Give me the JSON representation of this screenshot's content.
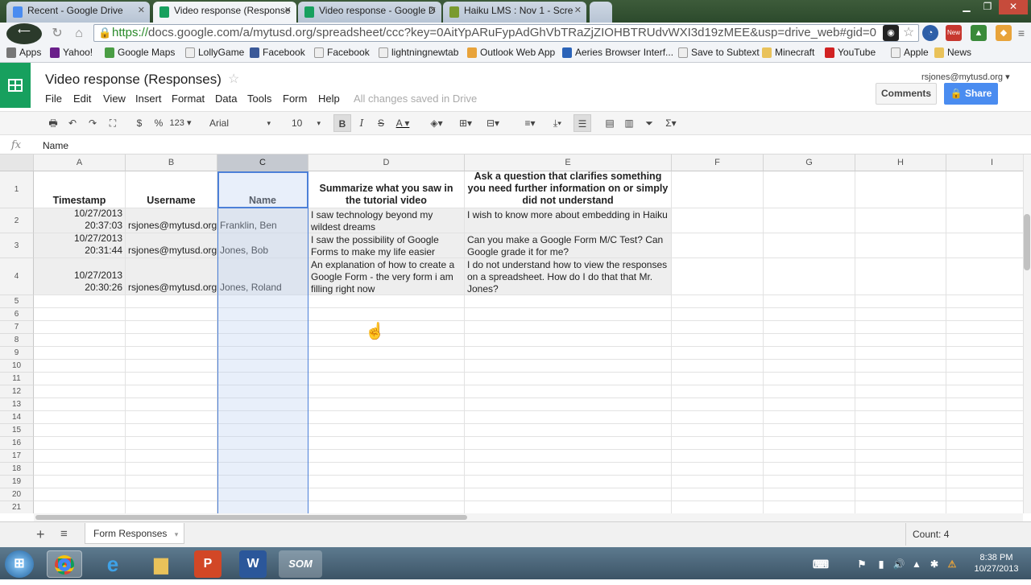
{
  "browser": {
    "tabs": [
      {
        "title": "Recent - Google Drive",
        "color": "#4a8cf0"
      },
      {
        "title": "Video response (Response",
        "color": "#17a05e",
        "active": true
      },
      {
        "title": "Video response - Google D",
        "color": "#17a05e"
      },
      {
        "title": "Haiku LMS : Nov 1 - Scre",
        "color": "#7a9a2e"
      }
    ],
    "url_scheme": "https://",
    "url_rest": "docs.google.com/a/mytusd.org/spreadsheet/ccc?key=0AitYpARuFypAdGhVbTRaZjZIOHBTRUdvWXI3d19zMEE&usp=drive_web#gid=0",
    "bookmarks": [
      {
        "label": "Apps",
        "icon": "apps-icon",
        "color": "#777"
      },
      {
        "label": "Yahoo!",
        "icon": "yahoo-icon",
        "color": "#6a1f8a"
      },
      {
        "label": "Google Maps",
        "icon": "maps-icon",
        "color": "#4a9d44"
      },
      {
        "label": "LollyGame",
        "icon": "page-icon",
        "color": "#eee"
      },
      {
        "label": "Facebook",
        "icon": "facebook-icon",
        "color": "#3b5998"
      },
      {
        "label": "Facebook",
        "icon": "page-icon",
        "color": "#eee"
      },
      {
        "label": "lightningnewtab",
        "icon": "page-icon",
        "color": "#eee"
      },
      {
        "label": "Outlook Web App",
        "icon": "outlook-icon",
        "color": "#e8a33a"
      },
      {
        "label": "Aeries Browser Interf...",
        "icon": "aeries-icon",
        "color": "#2b63b8"
      },
      {
        "label": "Save to Subtext",
        "icon": "page-icon",
        "color": "#eee"
      },
      {
        "label": "Minecraft",
        "icon": "folder-icon",
        "color": "#e9c25a"
      },
      {
        "label": "YouTube",
        "icon": "youtube-icon",
        "color": "#d12222"
      },
      {
        "label": "Apple",
        "icon": "page-icon",
        "color": "#eee"
      },
      {
        "label": "News",
        "icon": "folder-icon",
        "color": "#e9c25a"
      }
    ]
  },
  "doc": {
    "title": "Video response (Responses)",
    "menus": [
      "File",
      "Edit",
      "View",
      "Insert",
      "Format",
      "Data",
      "Tools",
      "Form",
      "Help"
    ],
    "saved_status": "All changes saved in Drive",
    "account": "rsjones@mytusd.org",
    "comments_label": "Comments",
    "share_label": "Share"
  },
  "toolbar": {
    "currency": "$",
    "percent": "%",
    "number_format": "123",
    "font": "Arial",
    "font_size": "10",
    "bold": "B",
    "italic": "I",
    "strike": "S",
    "text_color": "A"
  },
  "formula_bar": {
    "fx": "fx",
    "content": "Name"
  },
  "grid": {
    "columns": [
      "A",
      "B",
      "C",
      "D",
      "E",
      "F",
      "G",
      "H",
      "I"
    ],
    "header_row": [
      "Timestamp",
      "Username",
      "Name",
      "Summarize what you saw in the tutorial video",
      "Ask a question that clarifies something you need further information on or simply did not understand"
    ],
    "rows": [
      {
        "timestamp_date": "10/27/2013",
        "timestamp_time": "20:37:03",
        "username": "rsjones@mytusd.org",
        "name": "Franklin, Ben",
        "summary": "I saw technology beyond my wildest dreams",
        "question": "I wish to know more about embedding in Haiku"
      },
      {
        "timestamp_date": "10/27/2013",
        "timestamp_time": "20:31:44",
        "username": "rsjones@mytusd.org",
        "name": "Jones, Bob",
        "summary": "I saw the possibility of Google Forms to make my life easier",
        "question": "Can you make a Google Form M/C Test? Can Google grade it for me?"
      },
      {
        "timestamp_date": "10/27/2013",
        "timestamp_time": "20:30:26",
        "username": "rsjones@mytusd.org",
        "name": "Jones, Roland",
        "summary": "An explanation of how to create a Google Form - the very form i am filling right now",
        "question": "I do not understand how to view the responses on a spreadsheet. How do I do that that Mr. Jones?"
      }
    ],
    "row_numbers": [
      "1",
      "2",
      "3",
      "4",
      "5",
      "6",
      "7",
      "8",
      "9",
      "10",
      "11",
      "12",
      "13",
      "14",
      "15",
      "16",
      "17",
      "18",
      "19",
      "20",
      "21"
    ]
  },
  "sheets": {
    "tab_label": "Form Responses",
    "status": "Count: 4"
  },
  "taskbar": {
    "clock_time": "8:38 PM",
    "clock_date": "10/27/2013",
    "apps": [
      "start-orb",
      "chrome",
      "internet-explorer",
      "file-explorer",
      "powerpoint",
      "word",
      "screencast-o-matic"
    ]
  }
}
